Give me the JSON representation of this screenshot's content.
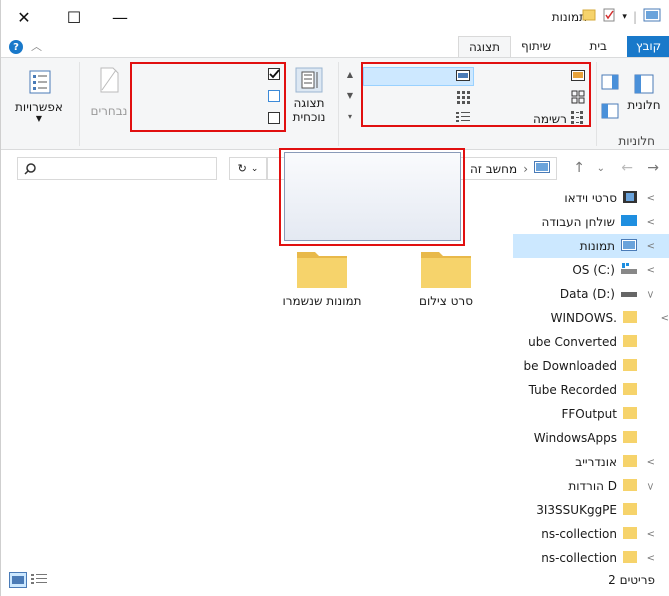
{
  "window": {
    "title": "תמונות",
    "controls": {
      "close": "✕",
      "maximize": "☐",
      "minimize": "—"
    }
  },
  "tabs": {
    "file": "קובץ",
    "home": "בית",
    "share": "שיתוף",
    "view": "תצוגה",
    "help": "?"
  },
  "ribbon": {
    "panes_label": "חלוניות",
    "preview_pane": "חלונית",
    "layout": {
      "list_label": "רשימה"
    },
    "sort_by": "תצוגה נוכחית",
    "hide_selected": "נבחרים",
    "options": "אפשרויות"
  },
  "address": {
    "path_item": "מחשב זה",
    "separator": "›"
  },
  "navpane": {
    "items": [
      {
        "label": "סרטי וידאו",
        "icon": "video-icon"
      },
      {
        "label": "שולחן העבודה",
        "icon": "desktop-icon"
      },
      {
        "label": "תמונות",
        "icon": "pictures-icon",
        "selected": true
      },
      {
        "label": "OS (C:)",
        "icon": "drive-icon"
      },
      {
        "label": "Data (D:)",
        "icon": "drive-icon"
      },
      {
        "label": "WINDOWS.",
        "icon": "folder-icon"
      },
      {
        "label": "ube Converted",
        "icon": "folder-icon"
      },
      {
        "label": "be Downloaded",
        "icon": "folder-icon"
      },
      {
        "label": "Tube Recorded",
        "icon": "folder-icon"
      },
      {
        "label": "FFOutput",
        "icon": "folder-icon"
      },
      {
        "label": "WindowsApps",
        "icon": "folder-icon"
      },
      {
        "label": "אונדרייב",
        "icon": "folder-icon"
      },
      {
        "label": "הורדות D",
        "icon": "folder-icon"
      },
      {
        "label": "3I3SSUKggPE",
        "icon": "folder-icon"
      },
      {
        "label": "ns-collection",
        "icon": "folder-icon"
      },
      {
        "label": "ns-collection",
        "icon": "folder-icon"
      }
    ]
  },
  "content": {
    "folders": [
      {
        "label": "סרט צילום"
      },
      {
        "label": "תמונות שנשמרו"
      }
    ]
  },
  "status": {
    "count": "2 פריטים"
  },
  "colors": {
    "accent": "#1979ca",
    "selection": "#cce8ff",
    "highlight_border": "#e11010",
    "folder": "#f6d36b"
  }
}
